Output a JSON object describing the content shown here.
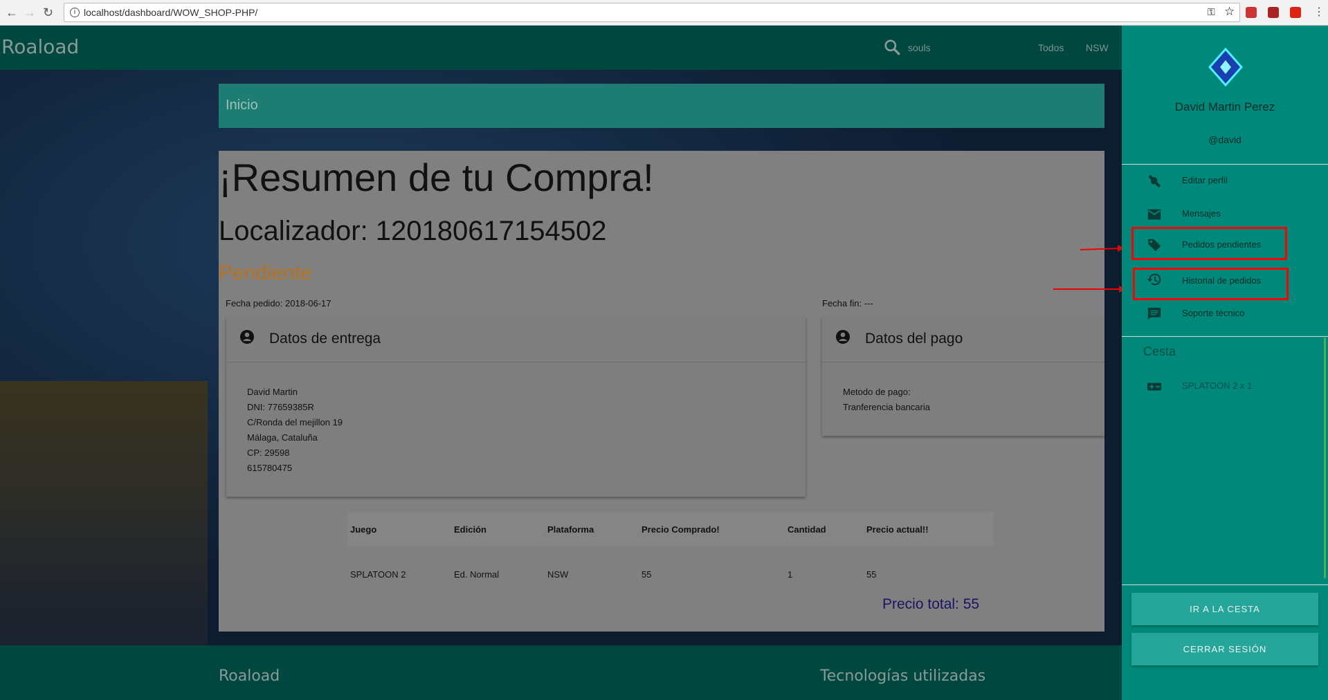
{
  "browser": {
    "url": "localhost/dashboard/WOW_SHOP-PHP/"
  },
  "header": {
    "logo": "Roaload",
    "search_text": "souls",
    "nav": [
      "Todos",
      "NSW"
    ]
  },
  "breadcrumb": "Inicio",
  "summary": {
    "title": "¡Resumen de tu Compra!",
    "locator": "Localizador: 120180617154502",
    "status": "Pendiente",
    "status_color": "#b5731f",
    "order_date": "Fecha pedido: 2018-06-17",
    "end_date": "Fecha fin: ---",
    "delivery": {
      "title": "Datos de entrega",
      "lines": [
        "David Martin",
        "DNI: 77659385R",
        "C/Ronda del mejillon 19",
        "Málaga, Cataluña",
        "CP: 29598",
        "615780475"
      ]
    },
    "payment": {
      "title": "Datos del pago",
      "lines": [
        "Metodo de pago:",
        "Tranferencia bancaria"
      ]
    },
    "table": {
      "headers": [
        "Juego",
        "Edición",
        "Plataforma",
        "Precio Comprado!",
        "Cantidad",
        "Precio actual!!"
      ],
      "rows": [
        [
          "SPLATOON 2",
          "Ed. Normal",
          "NSW",
          "55",
          "1",
          "55"
        ]
      ]
    },
    "total": "Precio total: 55"
  },
  "footer": {
    "logo": "Roaload",
    "tech": "Tecnologías utilizadas"
  },
  "sidebar": {
    "name": "David Martin Perez",
    "username": "@david",
    "items": [
      {
        "label": "Editar perfil",
        "icon": "wrench-icon"
      },
      {
        "label": "Mensajes",
        "icon": "mail-icon"
      },
      {
        "label": "Pedidos pendientes",
        "icon": "tag-icon"
      },
      {
        "label": "Historial de pedidos",
        "icon": "history-icon"
      },
      {
        "label": "Soporte técnico",
        "icon": "chat-icon"
      }
    ],
    "cart_title": "Cesta",
    "cart_items": [
      "SPLATOON 2 x 1"
    ],
    "buttons": [
      "IR A LA CESTA",
      "CERRAR SESIÓN"
    ]
  }
}
